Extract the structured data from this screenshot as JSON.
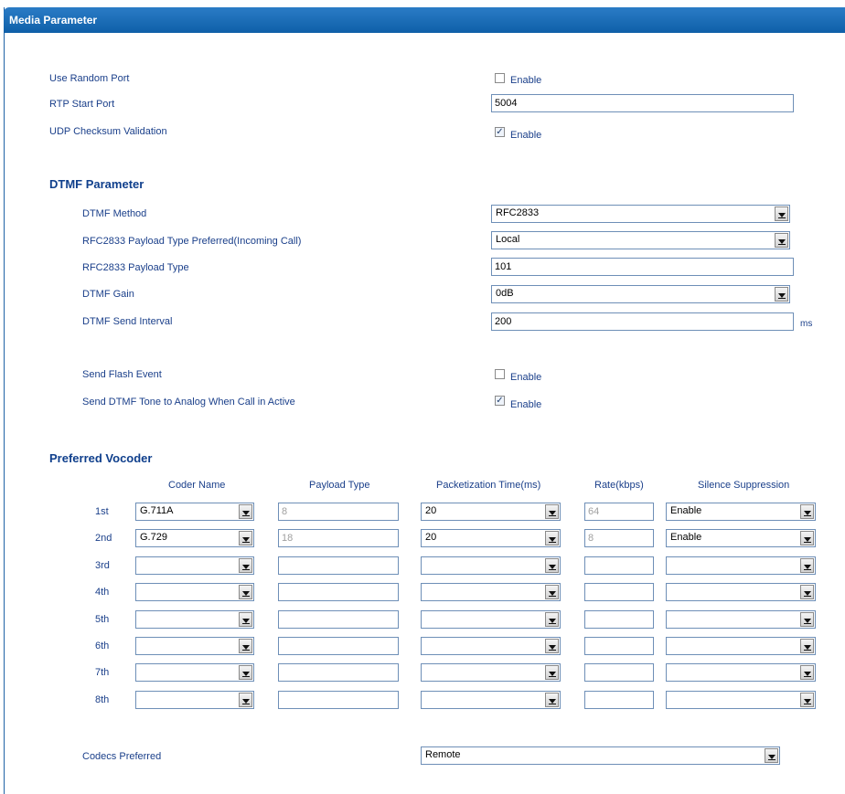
{
  "title": "Media Parameter",
  "media": {
    "use_random_port": {
      "label": "Use Random Port",
      "checked": false,
      "option": "Enable"
    },
    "rtp_start_port": {
      "label": "RTP Start Port",
      "value": "5004"
    },
    "udp_checksum": {
      "label": "UDP Checksum Validation",
      "checked": true,
      "option": "Enable"
    }
  },
  "dtmf": {
    "heading": "DTMF Parameter",
    "method": {
      "label": "DTMF Method",
      "value": "RFC2833"
    },
    "payload_pref": {
      "label": "RFC2833 Payload Type Preferred(Incoming Call)",
      "value": "Local"
    },
    "payload_type": {
      "label": "RFC2833 Payload Type",
      "value": "101"
    },
    "gain": {
      "label": "DTMF Gain",
      "value": "0dB"
    },
    "send_interval": {
      "label": "DTMF Send Interval",
      "value": "200",
      "unit": "ms"
    },
    "send_flash": {
      "label": "Send Flash Event",
      "checked": false,
      "option": "Enable"
    },
    "send_tone": {
      "label": "Send DTMF Tone to Analog When Call in Active",
      "checked": true,
      "option": "Enable"
    }
  },
  "vocoder": {
    "heading": "Preferred Vocoder",
    "columns": {
      "coder": "Coder Name",
      "payload": "Payload Type",
      "ptime": "Packetization Time(ms)",
      "rate": "Rate(kbps)",
      "silence": "Silence Suppression"
    },
    "rows": [
      {
        "label": "1st",
        "coder": "G.711A",
        "payload": "8",
        "ptime": "20",
        "rate": "64",
        "silence": "Enable"
      },
      {
        "label": "2nd",
        "coder": "G.729",
        "payload": "18",
        "ptime": "20",
        "rate": "8",
        "silence": "Enable"
      },
      {
        "label": "3rd",
        "coder": "",
        "payload": "",
        "ptime": "",
        "rate": "",
        "silence": ""
      },
      {
        "label": "4th",
        "coder": "",
        "payload": "",
        "ptime": "",
        "rate": "",
        "silence": ""
      },
      {
        "label": "5th",
        "coder": "",
        "payload": "",
        "ptime": "",
        "rate": "",
        "silence": ""
      },
      {
        "label": "6th",
        "coder": "",
        "payload": "",
        "ptime": "",
        "rate": "",
        "silence": ""
      },
      {
        "label": "7th",
        "coder": "",
        "payload": "",
        "ptime": "",
        "rate": "",
        "silence": ""
      },
      {
        "label": "8th",
        "coder": "",
        "payload": "",
        "ptime": "",
        "rate": "",
        "silence": ""
      }
    ]
  },
  "codecs_preferred": {
    "label": "Codecs Preferred",
    "value": "Remote"
  },
  "colors": {
    "header": "#0f5fa8",
    "label": "#1a3f8a",
    "heading": "#0f3f8c"
  }
}
